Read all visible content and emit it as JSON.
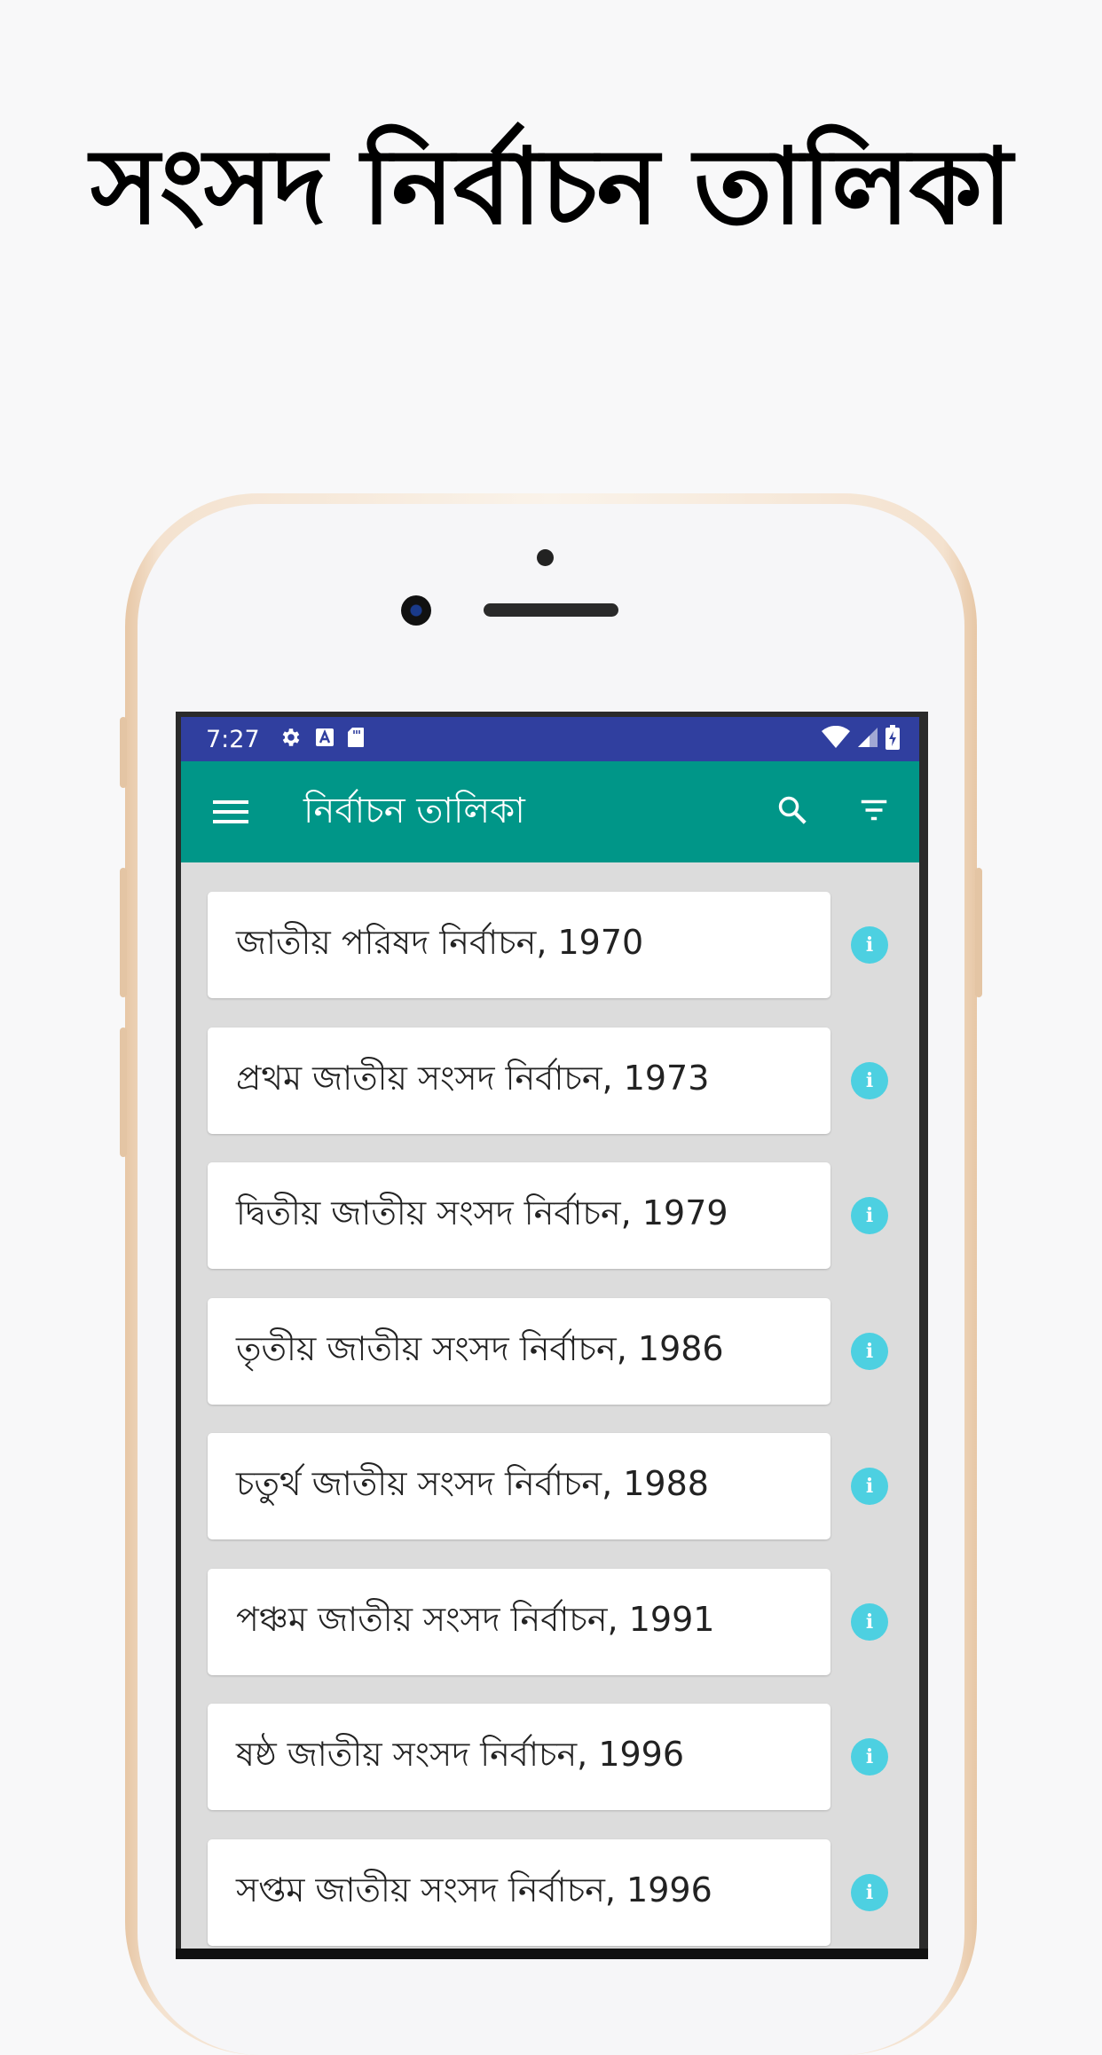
{
  "promo": {
    "headline": "সংসদ নির্বাচন তালিকা"
  },
  "status_bar": {
    "time": "7:27",
    "icons": [
      "settings-icon",
      "a-icon",
      "sd-card-icon",
      "wifi-icon",
      "signal-icon",
      "battery-charging-icon"
    ]
  },
  "app_bar": {
    "title": "নির্বাচন তালিকা",
    "icons": [
      "menu-icon",
      "search-icon",
      "filter-icon"
    ]
  },
  "elections": [
    {
      "label": "জাতীয় পরিষদ নির্বাচন, 1970"
    },
    {
      "label": "প্রথম জাতীয় সংসদ নির্বাচন, 1973"
    },
    {
      "label": "দ্বিতীয় জাতীয় সংসদ নির্বাচন, 1979"
    },
    {
      "label": "তৃতীয় জাতীয় সংসদ নির্বাচন, 1986"
    },
    {
      "label": "চতুর্থ জাতীয় সংসদ নির্বাচন, 1988"
    },
    {
      "label": "পঞ্চম জাতীয় সংসদ নির্বাচন, 1991"
    },
    {
      "label": "ষষ্ঠ জাতীয় সংসদ নির্বাচন, 1996"
    },
    {
      "label": "সপ্তম জাতীয় সংসদ নির্বাচন, 1996"
    }
  ],
  "colors": {
    "status_bar": "#303f9f",
    "app_bar": "#009688",
    "info": "#4dd0e1",
    "list_bg": "#dcdcdc"
  }
}
